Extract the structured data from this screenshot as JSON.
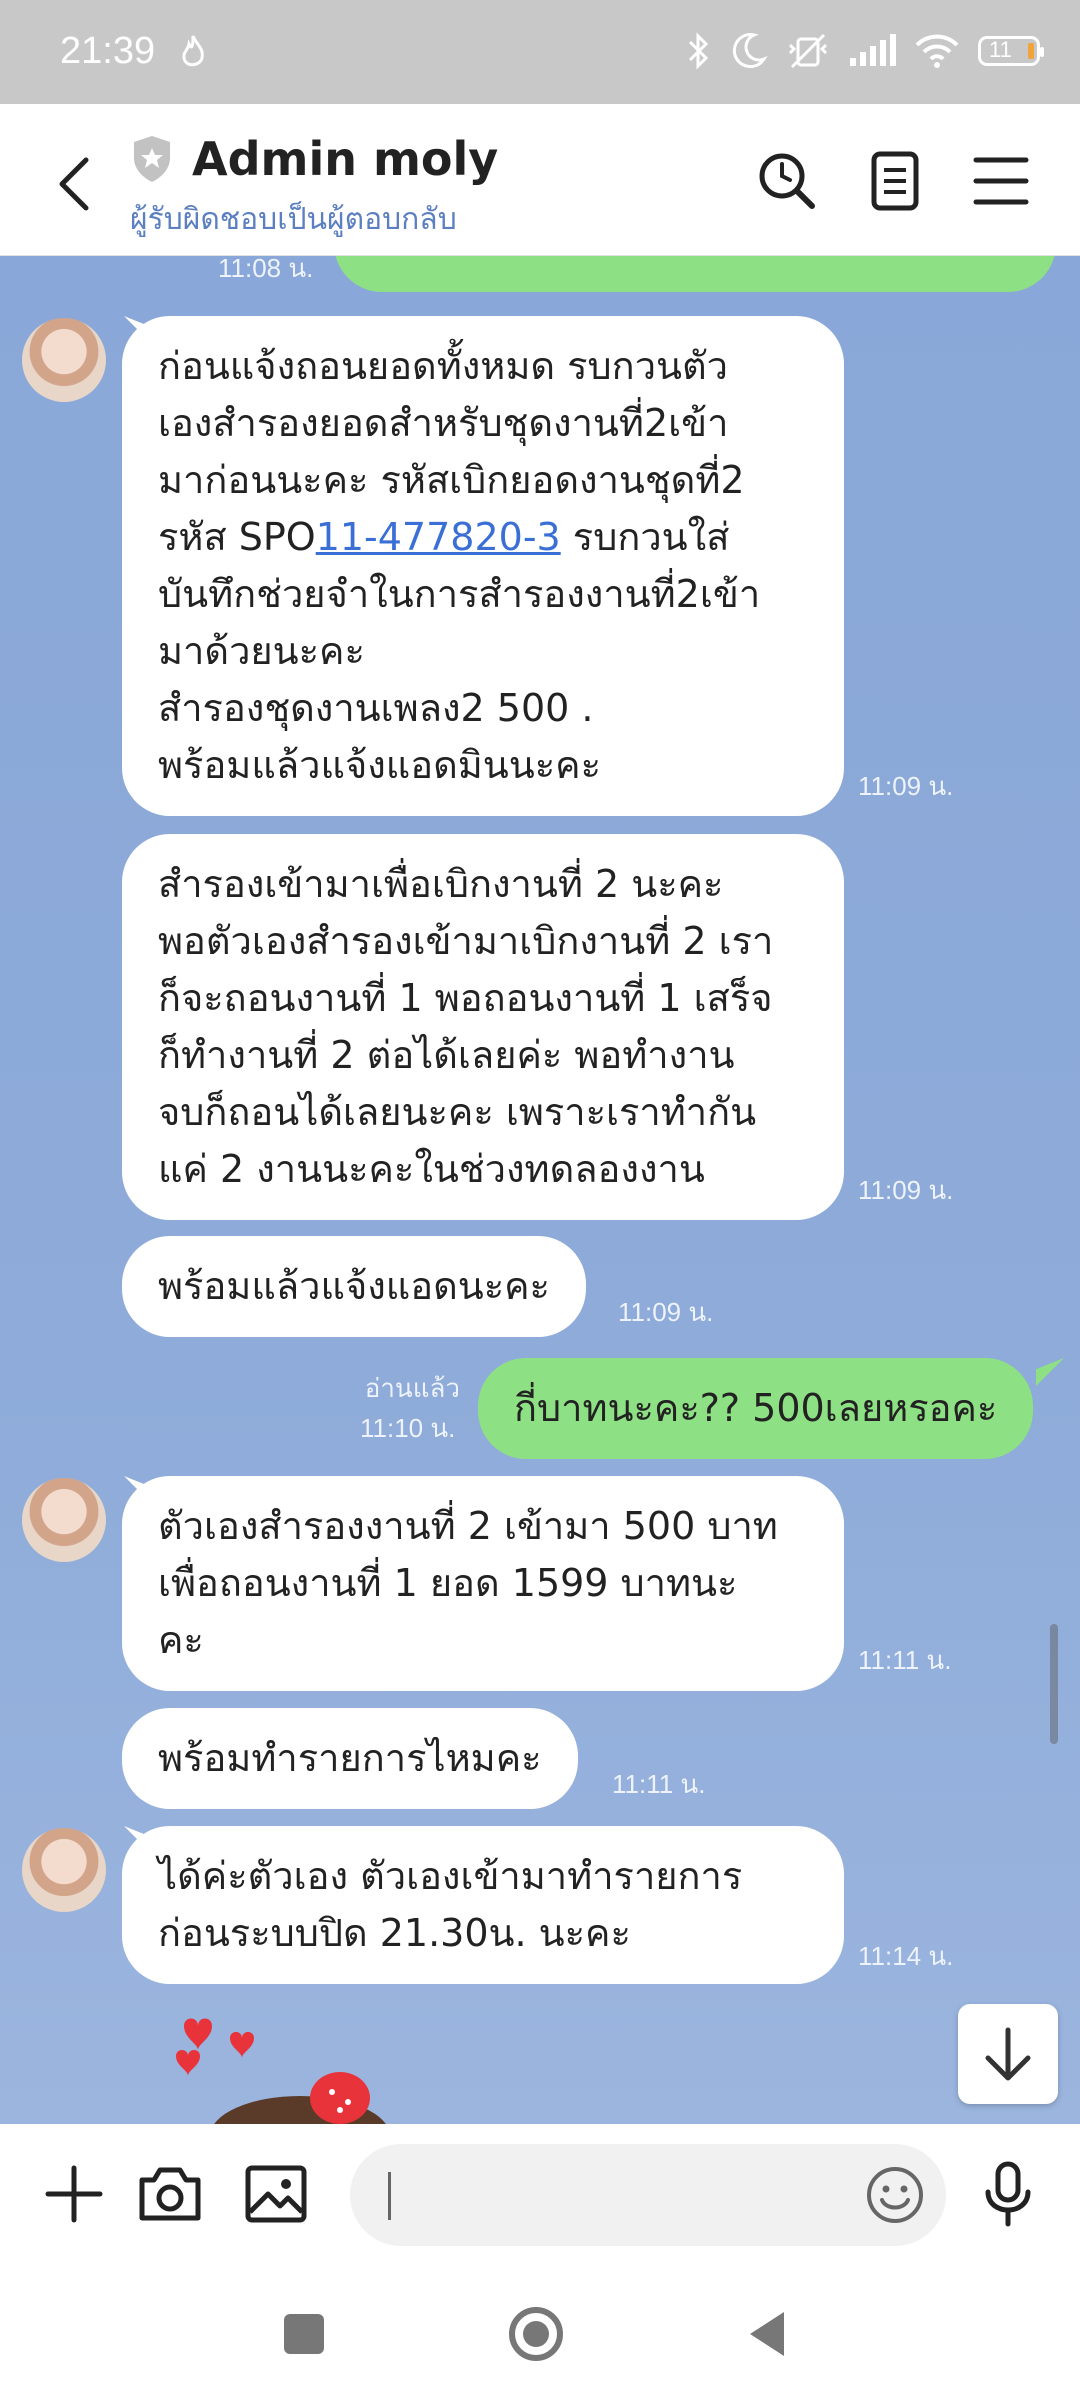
{
  "status_bar": {
    "time": "21:39",
    "battery": "11"
  },
  "header": {
    "title": "Admin moly",
    "subtitle": "ผู้รับผิดชอบเป็นผู้ตอบกลับ"
  },
  "messages": [
    {
      "time": "11:08 น."
    },
    {
      "lines_before_link": [
        "ก่อนแจ้งถอนยอดทั้งหมด รบกวนตัว",
        "เองสำรองยอดสำหรับชุดงานที่2เข้า",
        "มาก่อนนะคะ รหัสเบิกยอดงานชุดที่2"
      ],
      "link_prefix": "รหัส SPO",
      "link_text": "11-477820-3",
      "link_suffix": "  รบกวนใส่",
      "lines_after_link": [
        "บันทึกช่วยจำในการสำรองงานที่2เข้า",
        "มาด้วยนะคะ",
        "สำรองชุดงานเพลง2   500  .",
        "พร้อมแล้วแจ้งแอดมินนะคะ"
      ],
      "time": "11:09 น."
    },
    {
      "lines": [
        "สำรองเข้ามาเพื่อเบิกงานที่ 2 นะคะ",
        "พอตัวเองสำรองเข้ามาเบิกงานที่ 2 เรา",
        "ก็จะถอนงานที่ 1 พอถอนงานที่ 1 เสร็จ",
        "ก็ทำงานที่ 2 ต่อได้เลยค่ะ พอทำงาน",
        "จบก็ถอนได้เลยนะคะ เพราะเราทำกัน",
        "แค่ 2 งานนะคะในช่วงทดลองงาน"
      ],
      "time": "11:09 น."
    },
    {
      "text": "พร้อมแล้วแจ้งแอดนะคะ",
      "time": "11:09 น."
    },
    {
      "text": "กี่บาทนะคะ?? 500เลยหรอคะ",
      "read": "อ่านแล้ว",
      "time": "11:10 น."
    },
    {
      "lines": [
        "ตัวเองสำรองงานที่ 2 เข้ามา 500 บาท",
        "เพื่อถอนงานที่ 1 ยอด 1599 บาทนะ",
        "คะ"
      ],
      "time": "11:11 น."
    },
    {
      "text": "พร้อมทำรายการไหมคะ",
      "time": "11:11 น."
    },
    {
      "lines": [
        "ได้ค่ะตัวเอง ตัวเองเข้ามาทำรายการ",
        "ก่อนระบบปิด 21.30น. นะคะ"
      ],
      "time": "11:14 น."
    }
  ],
  "input": {
    "placeholder": ""
  },
  "colors": {
    "chat_bg": "#8aa8d8",
    "mine_bubble": "#8ee084",
    "link": "#3a6fd6"
  }
}
